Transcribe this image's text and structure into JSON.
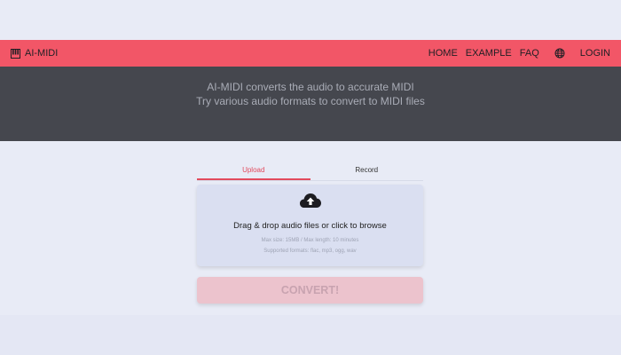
{
  "header": {
    "brand": "AI-MIDI",
    "nav": {
      "home": "HOME",
      "example": "EXAMPLE",
      "faq": "FAQ",
      "login": "LOGIN"
    },
    "icons": {
      "brand": "piano-icon",
      "language": "globe-icon"
    },
    "background_color": "#f25667"
  },
  "hero": {
    "line1": "AI-MIDI converts the audio to accurate MIDI",
    "line2": "Try various audio formats to convert to MIDI files",
    "background_color": "#45474e"
  },
  "tabs": [
    {
      "label": "Upload",
      "active": true
    },
    {
      "label": "Record",
      "active": false
    }
  ],
  "upload": {
    "icon": "cloud-upload-icon",
    "title": "Drag & drop audio files or click to browse",
    "limits": "Max size: 15MB / Max length: 10 minutes",
    "formats": "Supported formats: flac, mp3, ogg, wav"
  },
  "convert_button": {
    "label": "CONVERT!",
    "disabled": true
  },
  "accent_color": "#e24a5d"
}
